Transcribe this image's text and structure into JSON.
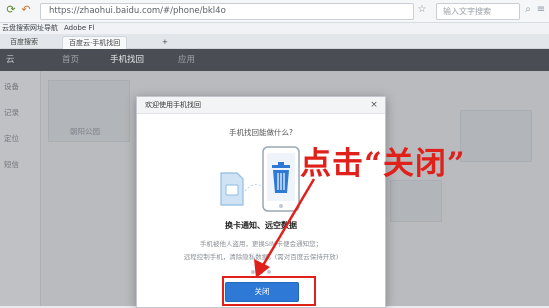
{
  "browser": {
    "url": "https://zhaohui.baidu.com/#/phone/bkl4o",
    "search_placeholder": "输入文字搜索",
    "bookmarks": [
      "云盘搜索",
      "网址导航",
      "Adobe Fl"
    ],
    "tabs": [
      {
        "label": "百度搜索"
      },
      {
        "label": "百度云·手机找回"
      }
    ],
    "new_tab": "+"
  },
  "site": {
    "logo_text": "云",
    "nav": [
      "首页",
      "手机找回",
      "应用"
    ]
  },
  "page": {
    "sidebar_items": [
      "设备",
      "记录",
      "定位",
      "短信"
    ],
    "map_label": "朝阳公园"
  },
  "dialog": {
    "title": "欢迎使用手机找回",
    "close": "×",
    "question": "手机找回能做什么?",
    "feature_title": "换卡通知、远空数据",
    "desc_line1": "手机被他人盗用，更换SIM卡便会通知您；",
    "desc_line2": "远程控制手机，清除隐私数据。(需对百度云保持开放)",
    "primary_button": "关闭",
    "carousel": {
      "total": 3,
      "active": 2
    }
  },
  "annotation": {
    "text": "点击“关闭”",
    "color": "#e0201a"
  },
  "colors": {
    "accent_blue": "#2e79d6",
    "header_dark": "#4a4e54",
    "annotation_red": "#e0201a"
  }
}
